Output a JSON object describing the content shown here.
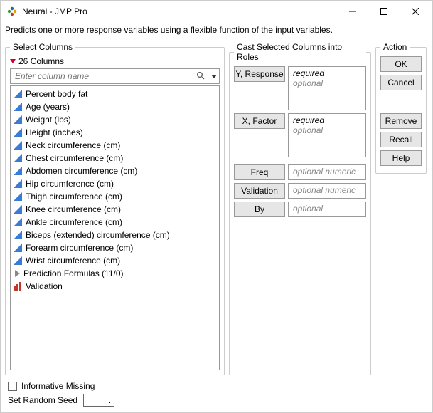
{
  "window": {
    "title": "Neural - JMP Pro"
  },
  "subtitle": "Predicts one or more response variables using a flexible function of the input variables.",
  "select": {
    "legend": "Select Columns",
    "count_label": "26 Columns",
    "search_placeholder": "Enter column name",
    "items": [
      {
        "label": "Percent body fat",
        "icon": "continuous"
      },
      {
        "label": "Age (years)",
        "icon": "continuous"
      },
      {
        "label": "Weight (lbs)",
        "icon": "continuous"
      },
      {
        "label": "Height (inches)",
        "icon": "continuous"
      },
      {
        "label": "Neck circumference (cm)",
        "icon": "continuous"
      },
      {
        "label": "Chest circumference (cm)",
        "icon": "continuous"
      },
      {
        "label": "Abdomen circumference (cm)",
        "icon": "continuous"
      },
      {
        "label": "Hip circumference (cm)",
        "icon": "continuous"
      },
      {
        "label": "Thigh circumference (cm)",
        "icon": "continuous"
      },
      {
        "label": "Knee circumference (cm)",
        "icon": "continuous"
      },
      {
        "label": "Ankle circumference (cm)",
        "icon": "continuous"
      },
      {
        "label": "Biceps (extended) circumference (cm)",
        "icon": "continuous"
      },
      {
        "label": "Forearm circumference (cm)",
        "icon": "continuous"
      },
      {
        "label": "Wrist circumference (cm)",
        "icon": "continuous"
      },
      {
        "label": "Prediction Formulas (11/0)",
        "icon": "group"
      },
      {
        "label": "Validation",
        "icon": "validation"
      }
    ]
  },
  "roles": {
    "legend": "Cast Selected Columns into Roles",
    "y_label": "Y, Response",
    "x_label": "X, Factor",
    "freq_label": "Freq",
    "validation_label": "Validation",
    "by_label": "By",
    "required": "required",
    "optional": "optional",
    "optional_numeric": "optional numeric"
  },
  "actions": {
    "legend": "Action",
    "ok": "OK",
    "cancel": "Cancel",
    "remove": "Remove",
    "recall": "Recall",
    "help": "Help"
  },
  "bottom": {
    "informative_missing": "Informative Missing",
    "seed_label": "Set Random Seed",
    "seed_value": "."
  }
}
